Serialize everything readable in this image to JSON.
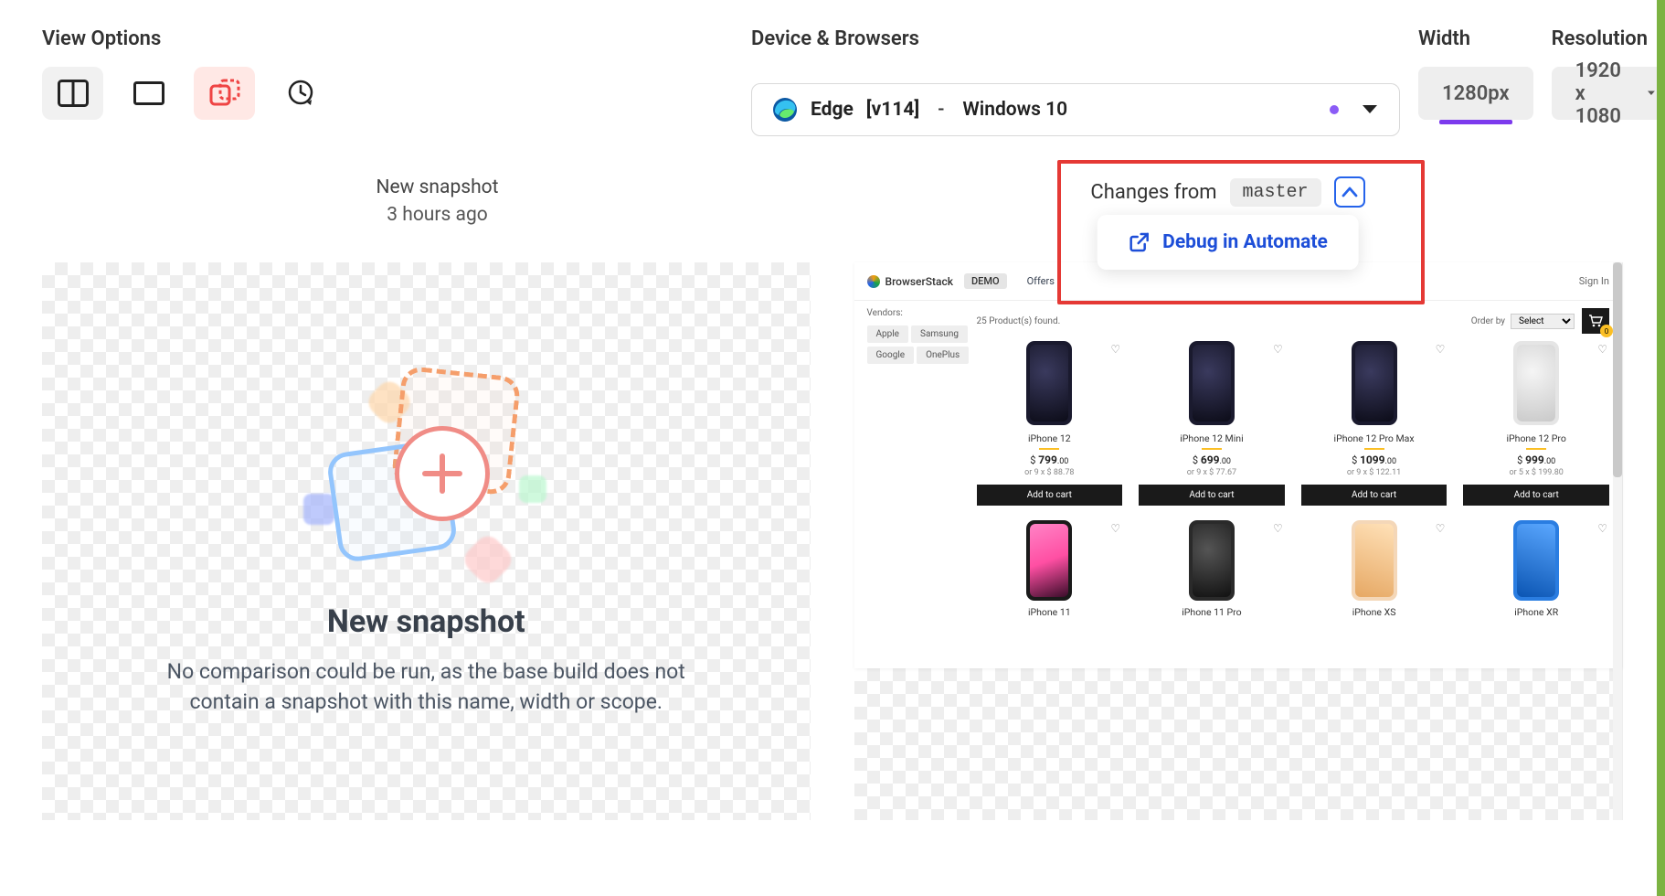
{
  "labels": {
    "view_options": "View Options",
    "device_browsers": "Device & Browsers",
    "width": "Width",
    "resolution": "Resolution"
  },
  "device": {
    "browser": "Edge",
    "browser_version": "[v114]",
    "separator": "-",
    "os": "Windows 10"
  },
  "width_value": "1280px",
  "resolution_value": "1920 x 1080",
  "left": {
    "header_title": "New snapshot",
    "header_time": "3 hours ago",
    "title": "New snapshot",
    "text_line1": "No comparison could be run, as the base build does not",
    "text_line2": "contain a snapshot with this name, width or scope."
  },
  "right": {
    "changes_from": "Changes from",
    "branch": "master",
    "obscured_time": "",
    "debug_label": "Debug in Automate"
  },
  "shot": {
    "brand": "BrowserStack",
    "demo": "DEMO",
    "nav1": "Offers",
    "signin": "Sign In",
    "vendors_label": "Vendors:",
    "tags": [
      "Apple",
      "Samsung",
      "Google",
      "OnePlus"
    ],
    "found": "25 Product(s) found.",
    "order_by_label": "Order by",
    "order_by_value": "Select",
    "cart_count": "0",
    "add_to_cart": "Add to cart",
    "products_row1": [
      {
        "name": "iPhone 12",
        "price": "799",
        "cents": ".00",
        "inst": "or 9 x $ 88.78",
        "body": "#1a1a2e",
        "screen": "radial-gradient(circle at 40% 35%,#3a3a5e,#0c0c18)"
      },
      {
        "name": "iPhone 12 Mini",
        "price": "699",
        "cents": ".00",
        "inst": "or 9 x $ 77.67",
        "body": "#1a1a2e",
        "screen": "radial-gradient(circle at 40% 35%,#3a3a5e,#0c0c18)"
      },
      {
        "name": "iPhone 12 Pro Max",
        "price": "1099",
        "cents": ".00",
        "inst": "or 9 x $ 122.11",
        "body": "#1a1a2e",
        "screen": "radial-gradient(circle at 40% 35%,#3a3a5e,#0c0c18)"
      },
      {
        "name": "iPhone 12 Pro",
        "price": "999",
        "cents": ".00",
        "inst": "or 5 x $ 199.80",
        "body": "#e5e5e5",
        "screen": "radial-gradient(circle at 40% 35%,#f5f5f5,#c9c9c9)"
      }
    ],
    "products_row2": [
      {
        "name": "iPhone 11",
        "body": "#1a1a1a",
        "screen": "linear-gradient(160deg,#ff83c6 0%,#ff4fa3 50%,#3a0d2a 100%)"
      },
      {
        "name": "iPhone 11 Pro",
        "body": "#2a2a2a",
        "screen": "radial-gradient(circle at 40% 35%,#555,#111)"
      },
      {
        "name": "iPhone XS",
        "body": "#f4d7b8",
        "screen": "linear-gradient(200deg,#ffe1b8,#e6a864)"
      },
      {
        "name": "iPhone XR",
        "body": "#2a7de1",
        "screen": "linear-gradient(200deg,#5aa7ff,#0b55b3)"
      }
    ]
  }
}
